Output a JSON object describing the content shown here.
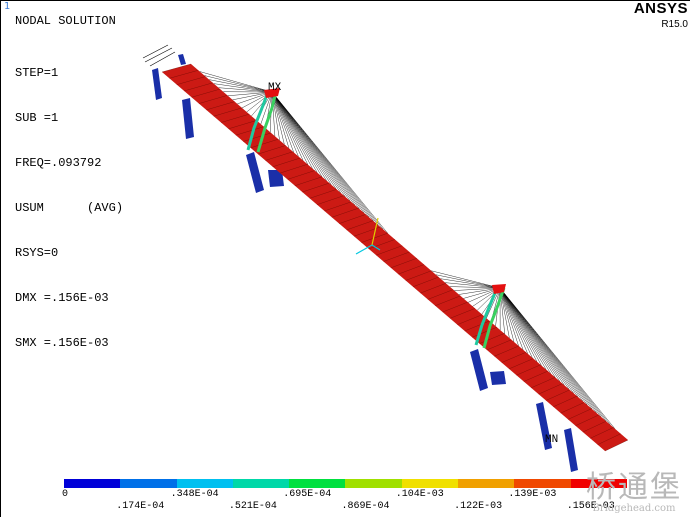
{
  "window_number": "1",
  "title": "NODAL SOLUTION",
  "info_lines": [
    "STEP=1",
    "SUB =1",
    "FREQ=.093792",
    "USUM      (AVG)",
    "RSYS=0",
    "DMX =.156E-03",
    "SMX =.156E-03"
  ],
  "brand": "ANSYS",
  "version": "R15.0",
  "markers": {
    "max": "MX",
    "min": "MN"
  },
  "legend": {
    "colors": [
      "#0000d8",
      "#0070e8",
      "#00c0f0",
      "#00d8a8",
      "#00e040",
      "#a0e000",
      "#f0e000",
      "#f0a000",
      "#f04800",
      "#f00000"
    ],
    "labels_top": [
      "0",
      ".348E-04",
      ".695E-04",
      ".104E-03",
      ".139E-03"
    ],
    "labels_bottom": [
      ".174E-04",
      ".521E-04",
      ".869E-04",
      ".122E-03",
      ".156E-03"
    ]
  },
  "watermark": {
    "chinese": "桥通堡",
    "english": "Bridgehead.com"
  }
}
